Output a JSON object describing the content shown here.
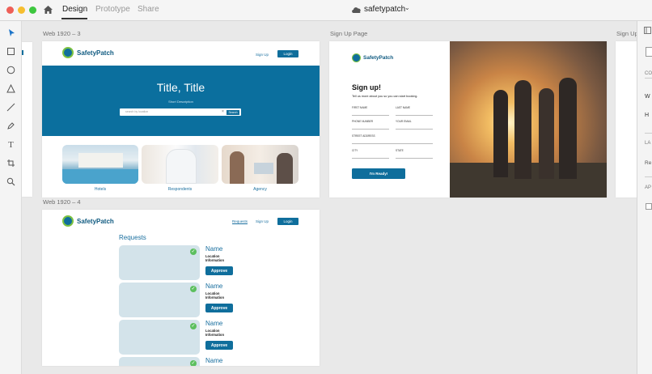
{
  "app": {
    "tabs": [
      "Design",
      "Prototype",
      "Share"
    ],
    "active_tab": "Design",
    "doc_title": "safetypatch",
    "colors": {
      "accent": "#0f6e9c",
      "hero": "#0b6f9e",
      "check": "#5cbf5e"
    }
  },
  "tools": [
    "select-icon",
    "rectangle-icon",
    "ellipse-icon",
    "polygon-icon",
    "line-icon",
    "pen-icon",
    "text-icon",
    "artboard-icon",
    "zoom-icon"
  ],
  "artboards": {
    "board1": {
      "label": "Web 1920 – 3",
      "brand": "SafetyPatch",
      "nav": {
        "signup": "Sign Up",
        "login": "Login"
      },
      "hero_title": "Title, Title",
      "hero_subtitle": "Short Description",
      "search_placeholder": "search by location",
      "search_button": "Search",
      "cards": [
        {
          "label": "Hotels"
        },
        {
          "label": "Respondents"
        },
        {
          "label": "Agency"
        }
      ]
    },
    "board2": {
      "label": "Sign Up Page",
      "brand": "SafetyPatch",
      "title": "Sign up!",
      "subtitle": "Tell us more about you so you can start booking.",
      "fields": {
        "first": "FIRST NAME",
        "last": "LAST NAME",
        "phone": "PHONE NUMBER",
        "email": "YOUR EMAIL",
        "street": "STREET ADDRESS",
        "city": "CITY",
        "state": "STATE"
      },
      "button": "I'm Ready!"
    },
    "board3": {
      "label": "Sign Up"
    },
    "board4": {
      "label": "Web 1920 – 4",
      "brand": "SafetyPatch",
      "nav": {
        "requests": "Requests",
        "signup": "Sign Up",
        "login": "Login"
      },
      "heading": "Requests",
      "items": [
        {
          "name": "Name",
          "line1": "Location",
          "line2": "Information",
          "button": "Approve"
        },
        {
          "name": "Name",
          "line1": "Location",
          "line2": "Information",
          "button": "Approve"
        },
        {
          "name": "Name",
          "line1": "Location",
          "line2": "Information",
          "button": "Approve"
        },
        {
          "name": "Name"
        }
      ]
    }
  },
  "properties": {
    "co": "CO",
    "w": "W",
    "h": "H",
    "la": "LA",
    "re": "Re",
    "ap": "AP"
  }
}
